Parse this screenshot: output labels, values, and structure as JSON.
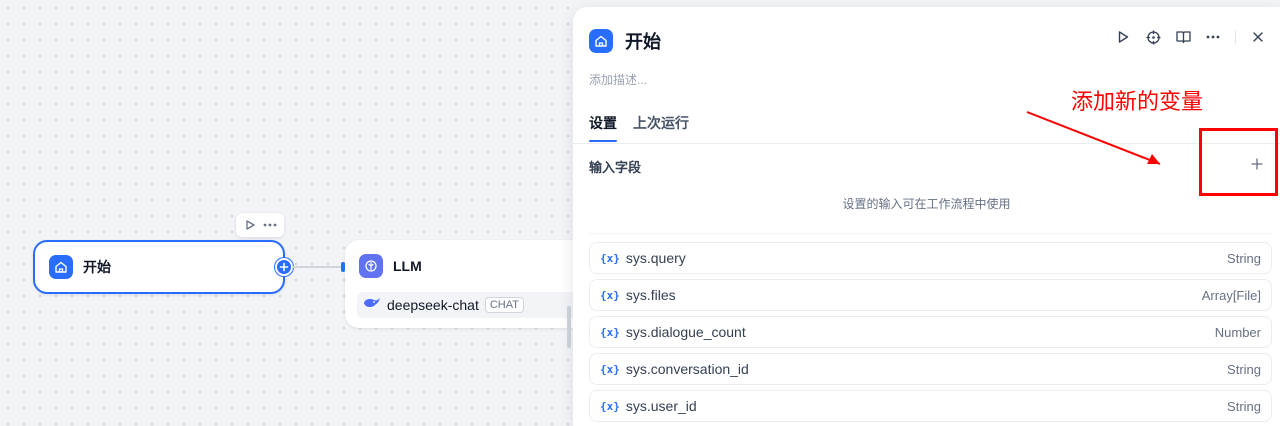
{
  "canvas": {
    "start_node": {
      "title": "开始"
    },
    "llm_node": {
      "title": "LLM",
      "model": {
        "name": "deepseek-chat",
        "mode": "CHAT"
      }
    }
  },
  "panel": {
    "title": "开始",
    "description_placeholder": "添加描述...",
    "tabs": [
      {
        "label": "设置",
        "active": true
      },
      {
        "label": "上次运行",
        "active": false
      }
    ],
    "input_section": {
      "title": "输入字段",
      "empty_hint": "设置的输入可在工作流程中使用",
      "variables": [
        {
          "icon": "{x}",
          "name": "sys.query",
          "type": "String"
        },
        {
          "icon": "{x}",
          "name": "sys.files",
          "type": "Array[File]"
        },
        {
          "icon": "{x}",
          "name": "sys.dialogue_count",
          "type": "Number"
        },
        {
          "icon": "{x}",
          "name": "sys.conversation_id",
          "type": "String"
        },
        {
          "icon": "{x}",
          "name": "sys.user_id",
          "type": "String"
        }
      ]
    }
  },
  "annotation": {
    "text": "添加新的变量",
    "color": "#ff0000"
  },
  "colors": {
    "accent": "#296dff",
    "llm_icon": "#6172f3"
  }
}
